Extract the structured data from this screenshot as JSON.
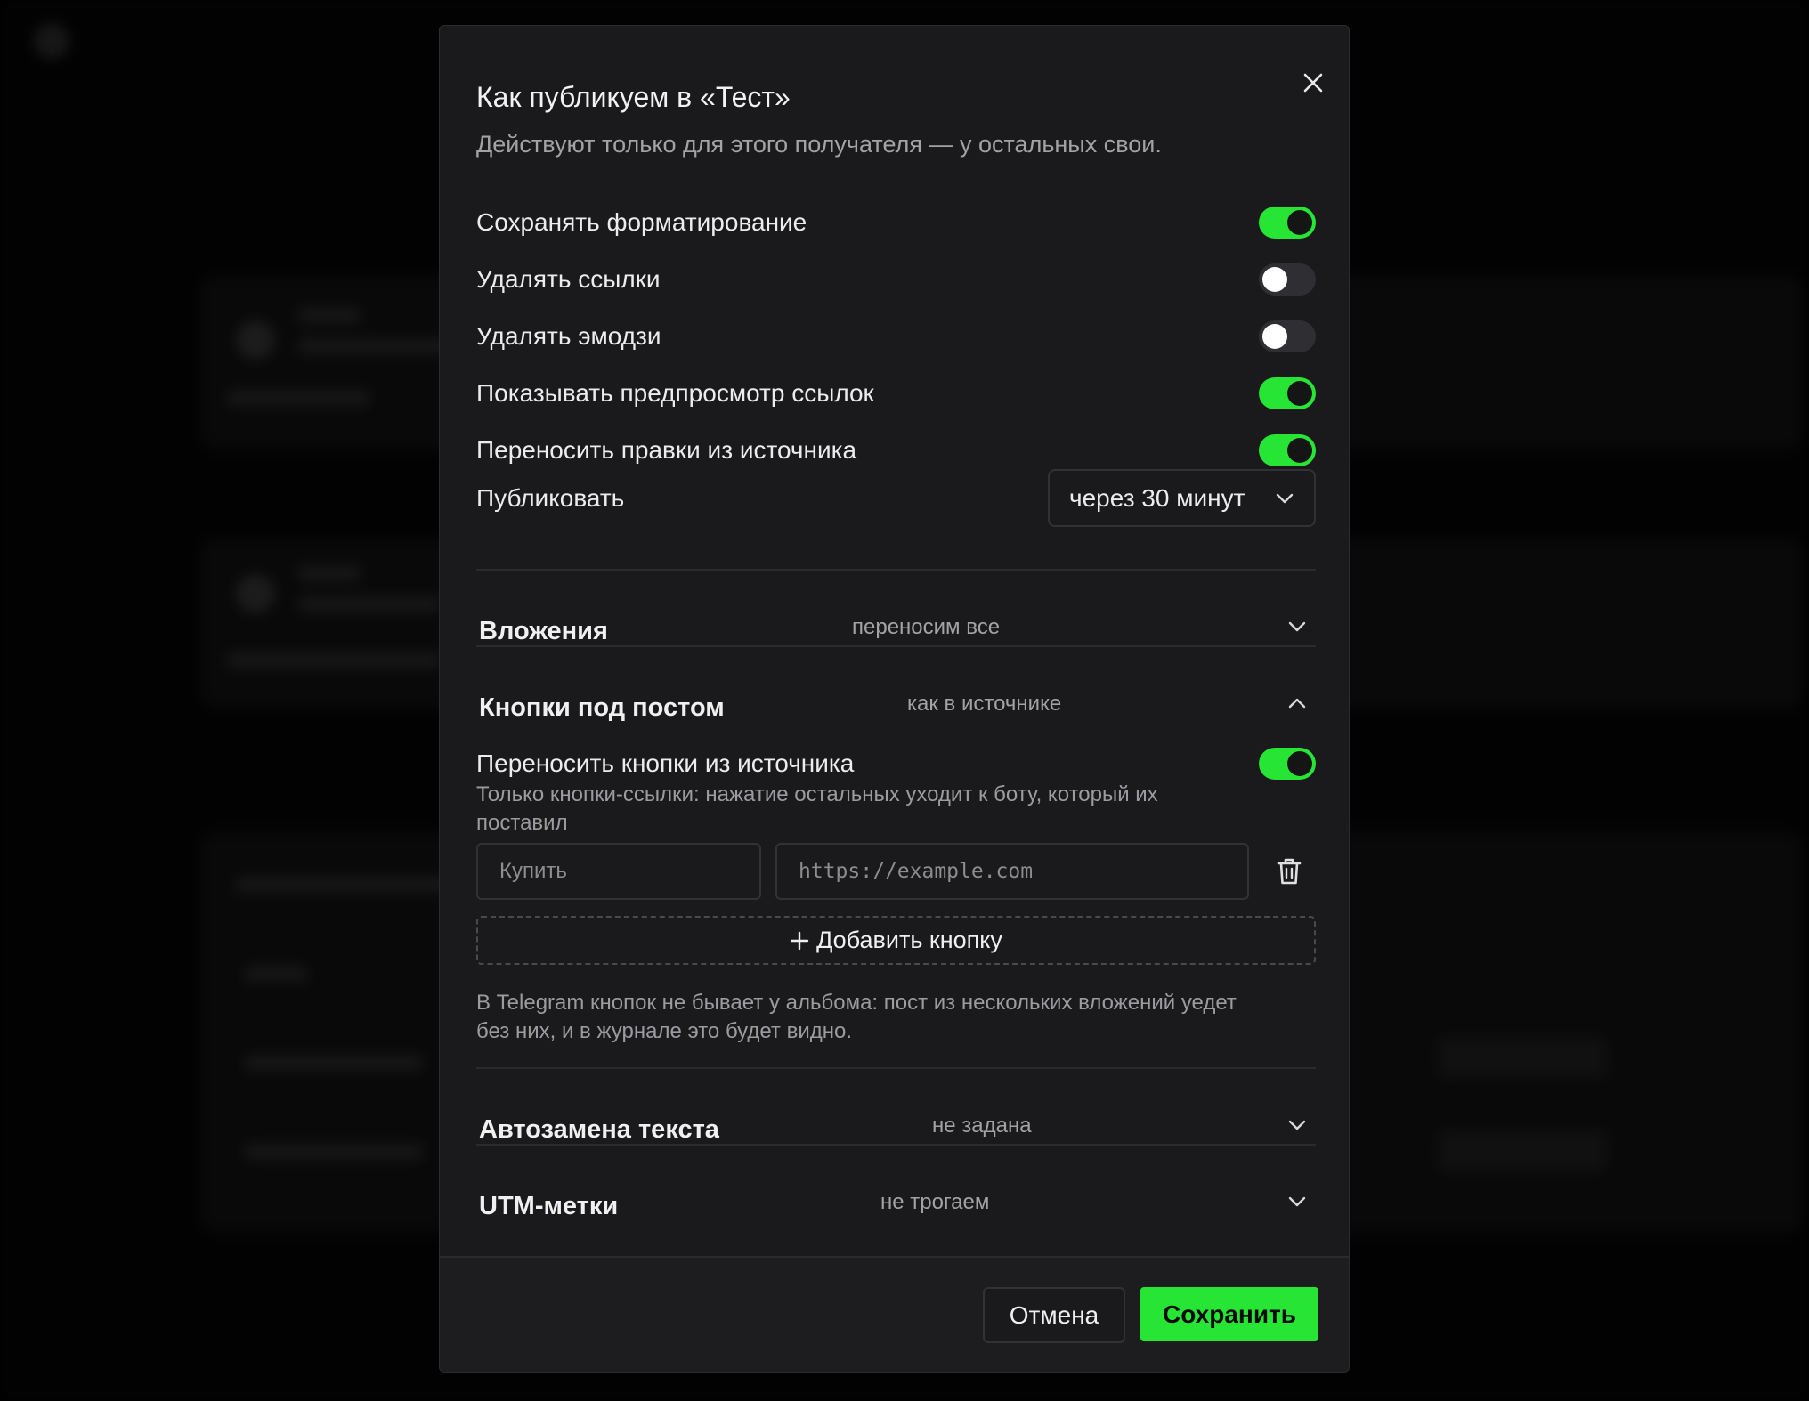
{
  "modal": {
    "title": "Как публикуем в «Тест»",
    "subtitle": "Действуют только для этого получателя — у остальных свои.",
    "close_icon": "close-icon"
  },
  "toggles": [
    {
      "label": "Сохранять форматирование",
      "on": true
    },
    {
      "label": "Удалять ссылки",
      "on": false
    },
    {
      "label": "Удалять эмодзи",
      "on": false
    },
    {
      "label": "Показывать предпросмотр ссылок",
      "on": true
    },
    {
      "label": "Переносить правки из источника",
      "on": true
    }
  ],
  "publish": {
    "label": "Публиковать",
    "selected": "через 30 минут"
  },
  "sections": {
    "attachments": {
      "title": "Вложения",
      "value": "переносим все",
      "expanded": false
    },
    "buttons": {
      "title": "Кнопки под постом",
      "value": "как в источнике",
      "expanded": true
    },
    "autoreplace": {
      "title": "Автозамена текста",
      "value": "не задана",
      "expanded": false
    },
    "utm": {
      "title": "UTM-метки",
      "value": "не трогаем",
      "expanded": false
    }
  },
  "buttons_section": {
    "toggle_label": "Переносить кнопки из источника",
    "toggle_on": true,
    "toggle_help_line1": "Только кнопки-ссылки: нажатие остальных уходит к боту, который их",
    "toggle_help_line2": "поставил",
    "button_name_placeholder": "Купить",
    "button_url_placeholder": "https://example.com",
    "add_button_label": "Добавить кнопку",
    "note_line1": "В Telegram кнопок не бывает у альбома: пост из нескольких вложений уедет",
    "note_line2": "без них, и в журнале это будет видно."
  },
  "footer": {
    "cancel_label": "Отмена",
    "save_label": "Сохранить"
  },
  "colors": {
    "accent": "#27e534",
    "modal_bg": "#1a1a1c",
    "backdrop": "#000000"
  }
}
